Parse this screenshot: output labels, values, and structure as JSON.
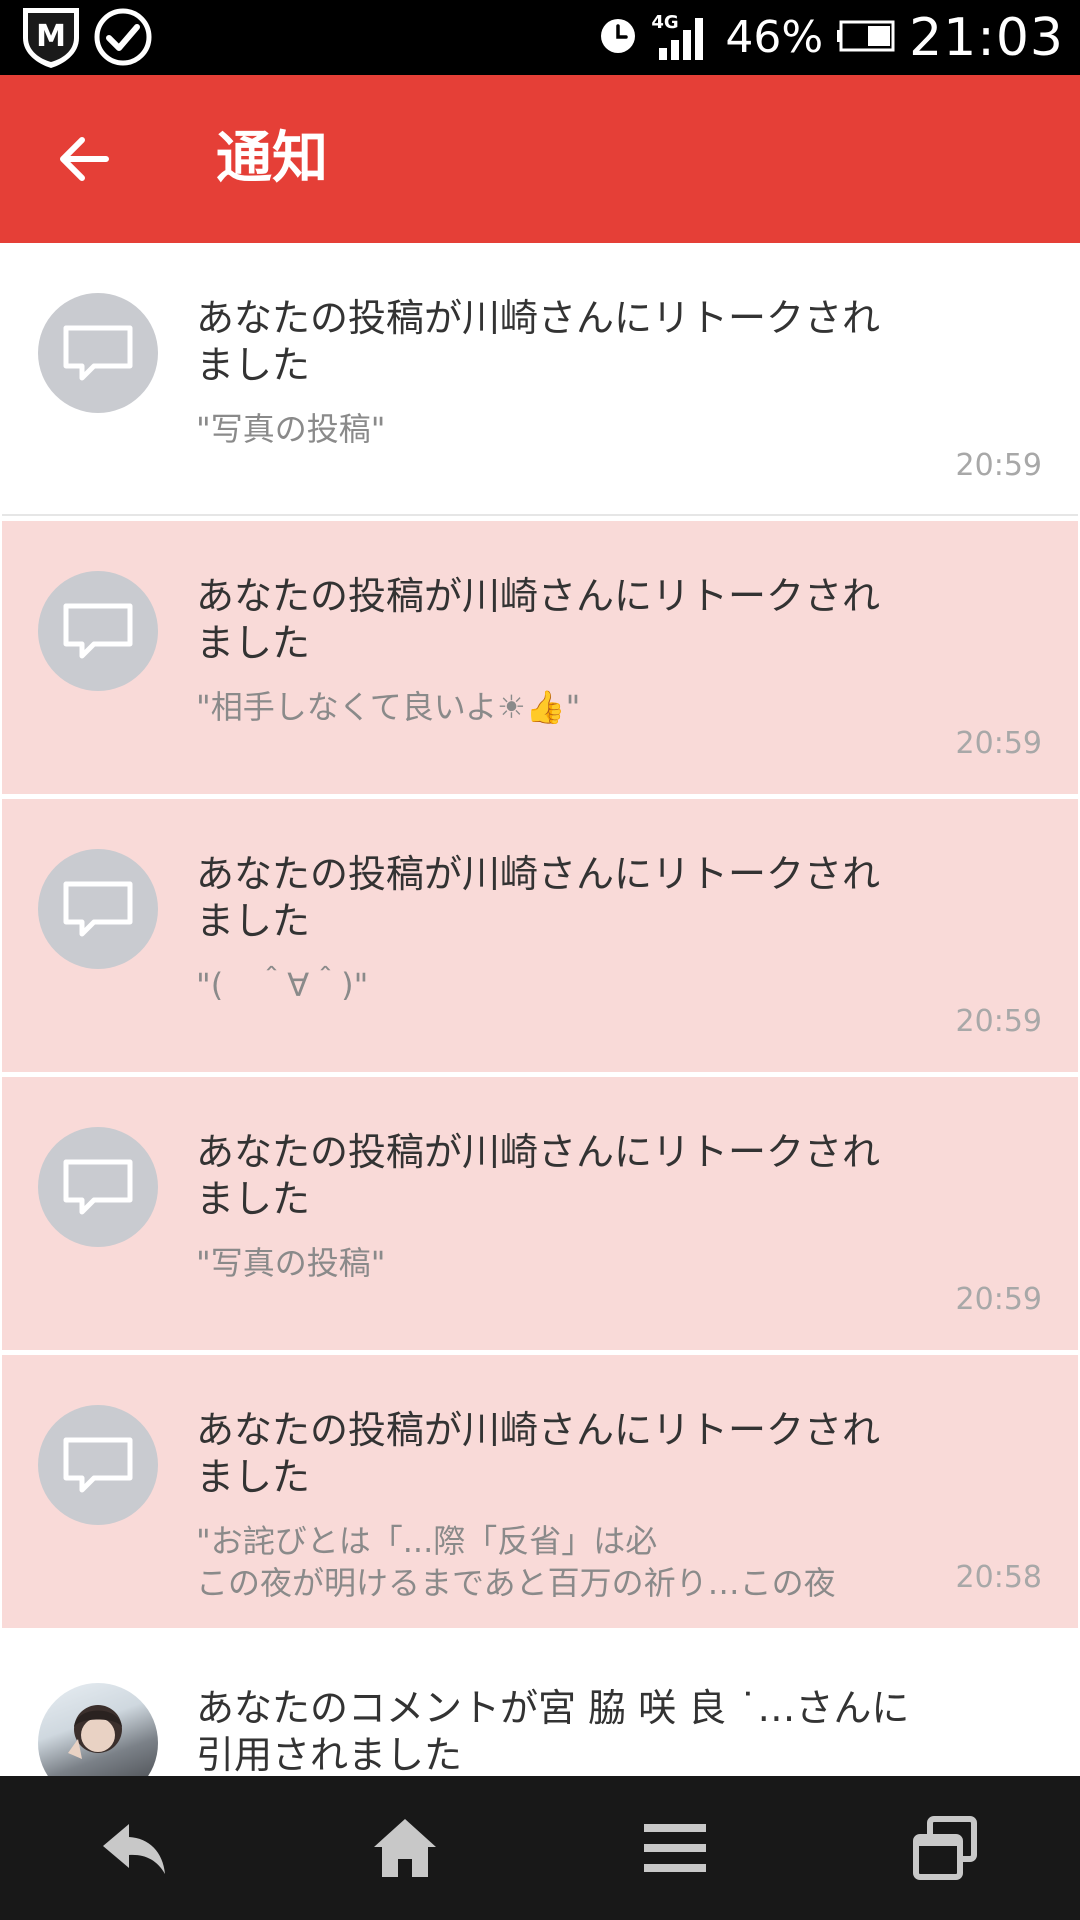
{
  "status_bar": {
    "network": "4G",
    "battery": "46%",
    "clock": "21:03",
    "icons": [
      "shield-m-icon",
      "check-circle-icon",
      "alarm-icon",
      "signal-icon",
      "battery-icon"
    ]
  },
  "app_bar": {
    "title": "通知",
    "back_icon": "arrow-left-icon",
    "color": "#e53f37"
  },
  "notifications": [
    {
      "title": "あなたの投稿が川崎さんにリトークされました",
      "snippet": "\"写真の投稿\"",
      "time": "20:59",
      "unread": false,
      "icon": "chat-bubble-icon"
    },
    {
      "title": "あなたの投稿が川崎さんにリトークされました",
      "snippet": "\"相手しなくて良いよ☀👍\"",
      "time": "20:59",
      "unread": true,
      "icon": "chat-bubble-icon"
    },
    {
      "title": "あなたの投稿が川崎さんにリトークされました",
      "snippet": "\"(　＾∀＾)\"",
      "time": "20:59",
      "unread": true,
      "icon": "chat-bubble-icon"
    },
    {
      "title": "あなたの投稿が川崎さんにリトークされました",
      "snippet": "\"写真の投稿\"",
      "time": "20:59",
      "unread": true,
      "icon": "chat-bubble-icon"
    },
    {
      "title": "あなたの投稿が川崎さんにリトークされました",
      "snippet": "\"お詫びとは「...際「反省」は必\n この夜が明けるまであと百万の祈り…この夜",
      "time": "20:58",
      "unread": true,
      "icon": "chat-bubble-icon"
    },
    {
      "title": "あなたのコメントが宮 脇 咲 良 ˙…さんに引用されました",
      "snippet": "",
      "time": "",
      "unread": false,
      "icon": "user-photo-avatar"
    }
  ],
  "colors": {
    "unread_bg": "#f9dad8",
    "read_bg": "#ffffff",
    "avatar_grey": "#c9cbd0"
  },
  "nav_bar": {
    "icons": [
      "back-arrow-icon",
      "home-icon",
      "menu-icon",
      "recent-apps-icon"
    ]
  }
}
